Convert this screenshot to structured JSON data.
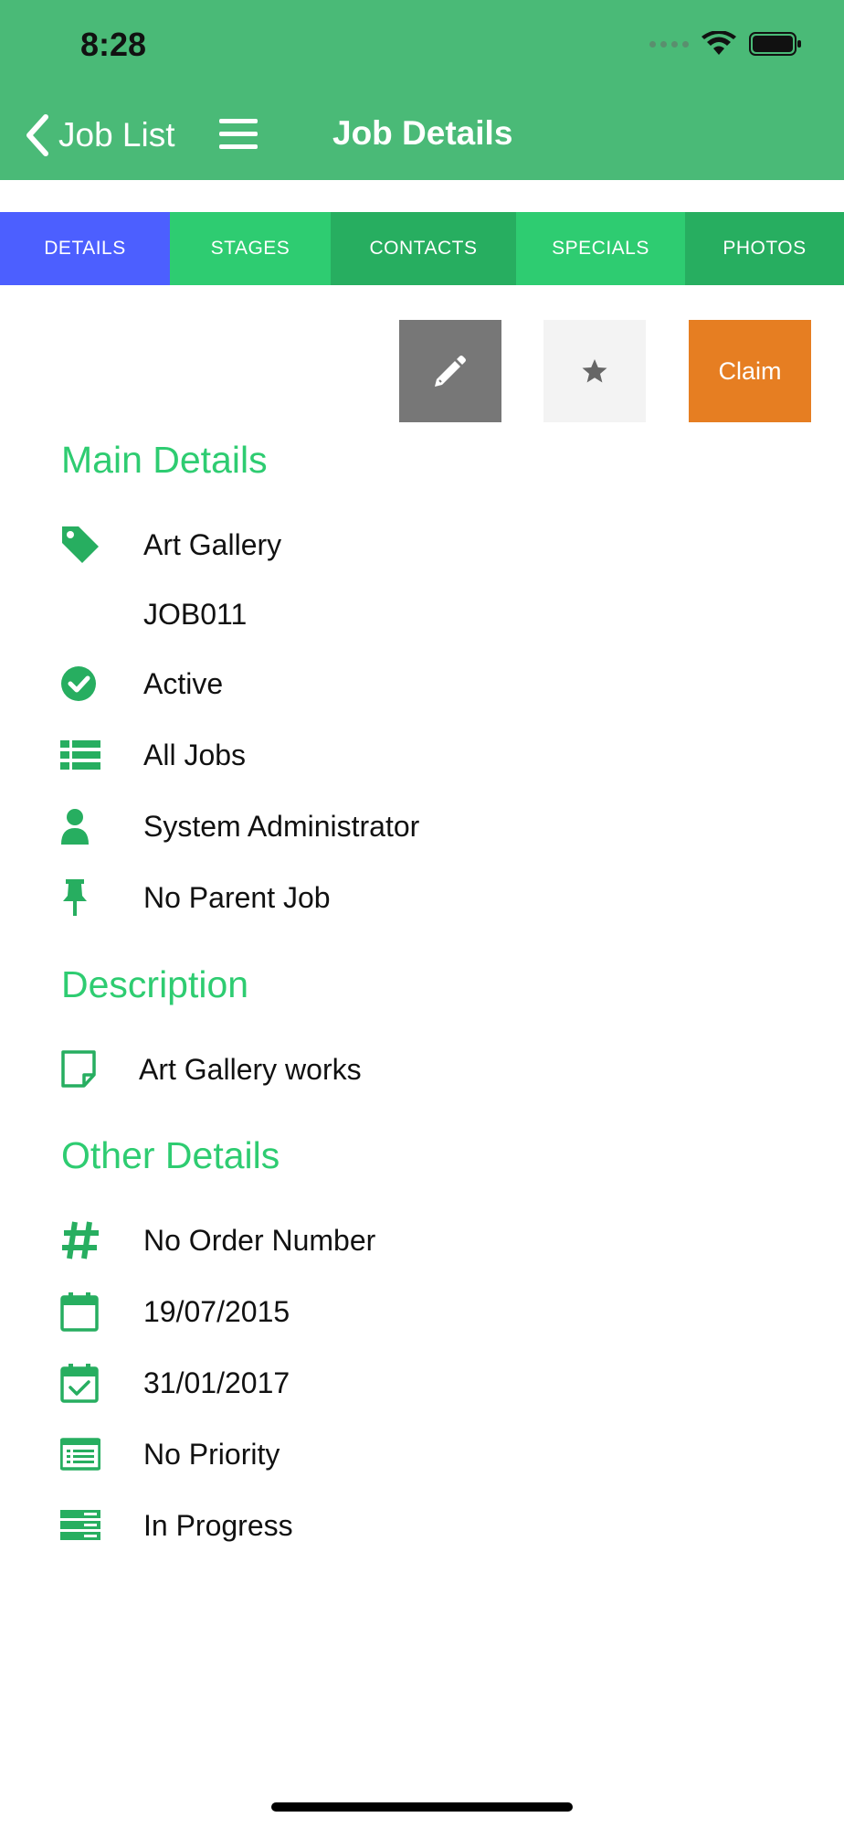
{
  "status_bar": {
    "time": "8:28"
  },
  "nav": {
    "back_label": "Job List",
    "title": "Job Details"
  },
  "tabs": [
    {
      "label": "DETAILS",
      "color": "#4c5fff",
      "active": true
    },
    {
      "label": "STAGES",
      "color": "#2ecc71",
      "active": false
    },
    {
      "label": "CONTACTS",
      "color": "#27ae60",
      "active": false
    },
    {
      "label": "SPECIALS",
      "color": "#2ecc71",
      "active": false
    },
    {
      "label": "PHOTOS",
      "color": "#27ae60",
      "active": false
    }
  ],
  "actions": {
    "edit_icon": "pencil-icon",
    "favorite_icon": "star-icon",
    "claim_label": "Claim"
  },
  "main_details": {
    "title": "Main Details",
    "items": [
      {
        "icon": "tag-icon",
        "text": "Art Gallery"
      },
      {
        "icon": "",
        "text": "JOB011"
      },
      {
        "icon": "check-circle-icon",
        "text": "Active"
      },
      {
        "icon": "list-icon",
        "text": "All Jobs"
      },
      {
        "icon": "user-icon",
        "text": "System Administrator"
      },
      {
        "icon": "pushpin-icon",
        "text": "No Parent Job"
      }
    ]
  },
  "description": {
    "title": "Description",
    "text": "Art Gallery works",
    "icon": "note-icon"
  },
  "other_details": {
    "title": "Other Details",
    "items": [
      {
        "icon": "hash-icon",
        "text": "No Order Number"
      },
      {
        "icon": "calendar-icon",
        "text": "19/07/2015"
      },
      {
        "icon": "calendar-check-icon",
        "text": "31/01/2017"
      },
      {
        "icon": "priority-list-icon",
        "text": "No Priority"
      },
      {
        "icon": "status-stack-icon",
        "text": "In Progress"
      }
    ]
  },
  "colors": {
    "header": "#4aba77",
    "accent_green": "#2ecc71",
    "icon_green": "#27ae60",
    "claim_orange": "#e67e22"
  }
}
